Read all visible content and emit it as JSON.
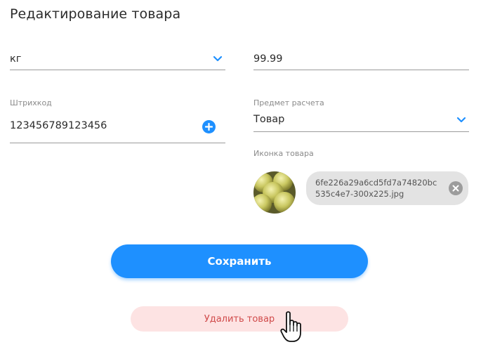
{
  "page": {
    "title": "Редактирование товара"
  },
  "unit_field": {
    "value": "кг",
    "icon": "chevron-down-icon"
  },
  "price_field": {
    "value": "99.99"
  },
  "barcode_field": {
    "label": "Штрихкод",
    "value": "123456789123456",
    "icon": "plus-circle-icon"
  },
  "payment_subject_field": {
    "label": "Предмет расчета",
    "value": "Товар",
    "icon": "chevron-down-icon"
  },
  "product_icon": {
    "label": "Иконка товара",
    "file_name": "6fe226a29a6cd5fd7a74820bc535c4e7-300x225.jpg",
    "remove_icon": "close-circle-icon"
  },
  "actions": {
    "save_label": "Сохранить",
    "delete_label": "Удалить товар"
  },
  "colors": {
    "accent": "#1e90ff",
    "danger_text": "#d04a4a",
    "danger_bg": "#fde3e3",
    "chip_bg": "#e3e3e3"
  }
}
